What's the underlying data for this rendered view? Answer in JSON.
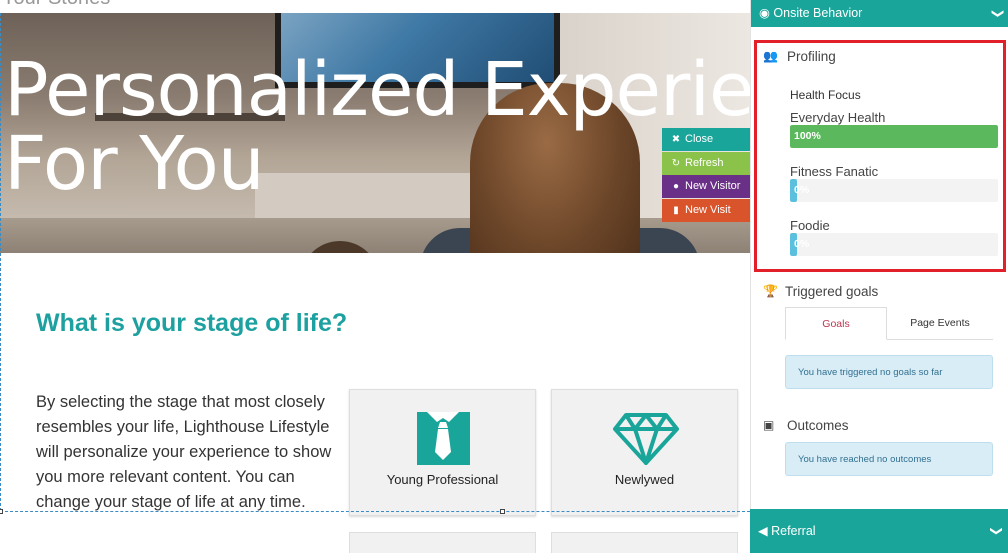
{
  "page": {
    "top_partial_text": "Your Stories",
    "hero_title_line1": "Personalized Experienc",
    "hero_title_line2": "For You",
    "stage_heading": "What is your stage of life?",
    "stage_description": "By selecting the stage that most closely resembles your life, Lighthouse Lifestyle will personalize your experience to show you more relevant content. You can change your stage of life at any time.",
    "cards": [
      {
        "label": "Young Professional",
        "icon": "tie-icon"
      },
      {
        "label": "Newlywed",
        "icon": "diamond-icon"
      }
    ]
  },
  "actions": [
    {
      "label": "Close",
      "icon": "close-icon",
      "color": "#1aa59a"
    },
    {
      "label": "Refresh",
      "icon": "refresh-icon",
      "color": "#8bc34a"
    },
    {
      "label": "New Visitor",
      "icon": "user-icon",
      "color": "#6a2f86"
    },
    {
      "label": "New Visit",
      "icon": "document-icon",
      "color": "#d9542b"
    }
  ],
  "panel": {
    "header": "Onsite Behavior",
    "profiling": {
      "title": "Profiling",
      "profile_key": "Health Focus",
      "rows": [
        {
          "label": "Everyday Health",
          "percent_text": "100%",
          "percent": 100,
          "color": "#5cb85c"
        },
        {
          "label": "Fitness Fanatic",
          "percent_text": "0%",
          "percent": 0,
          "color": "#5bc0de"
        },
        {
          "label": "Foodie",
          "percent_text": "0%",
          "percent": 0,
          "color": "#5bc0de"
        }
      ]
    },
    "goals": {
      "title": "Triggered goals",
      "tabs": [
        {
          "label": "Goals",
          "active": true
        },
        {
          "label": "Page Events",
          "active": false
        }
      ],
      "empty_message": "You have triggered no goals so far"
    },
    "outcomes": {
      "title": "Outcomes",
      "empty_message": "You have reached no outcomes"
    },
    "referral": "Referral"
  },
  "colors": {
    "accent": "#1aa59a",
    "heading": "#1da0a0",
    "highlight_border": "#e2202a"
  }
}
